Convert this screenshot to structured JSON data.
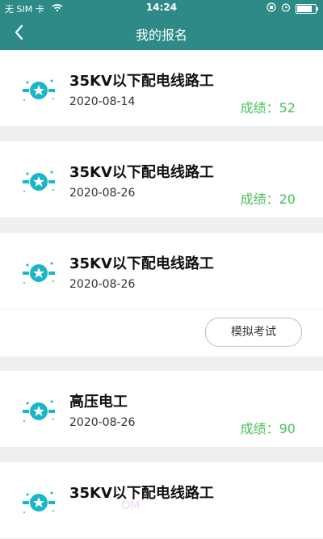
{
  "status": {
    "carrier": "无 SIM 卡",
    "time": "14:24",
    "battery_level": 0.8
  },
  "nav": {
    "title": "我的报名"
  },
  "items": [
    {
      "title": "35KV以下配电线路工",
      "date": "2020-08-14",
      "score": "成绩：52"
    },
    {
      "title": "35KV以下配电线路工",
      "date": "2020-08-26",
      "score": "成绩：20"
    },
    {
      "title": "35KV以下配电线路工",
      "date": "2020-08-26",
      "button": "模拟考试"
    },
    {
      "title": "高压电工",
      "date": "2020-08-26",
      "score": "成绩：90"
    },
    {
      "title": "35KV以下配电线路工"
    }
  ],
  "watermark": "OM",
  "colors": {
    "header": "#2d8a86",
    "score": "#49c25a",
    "badge": "#19b6c8"
  }
}
